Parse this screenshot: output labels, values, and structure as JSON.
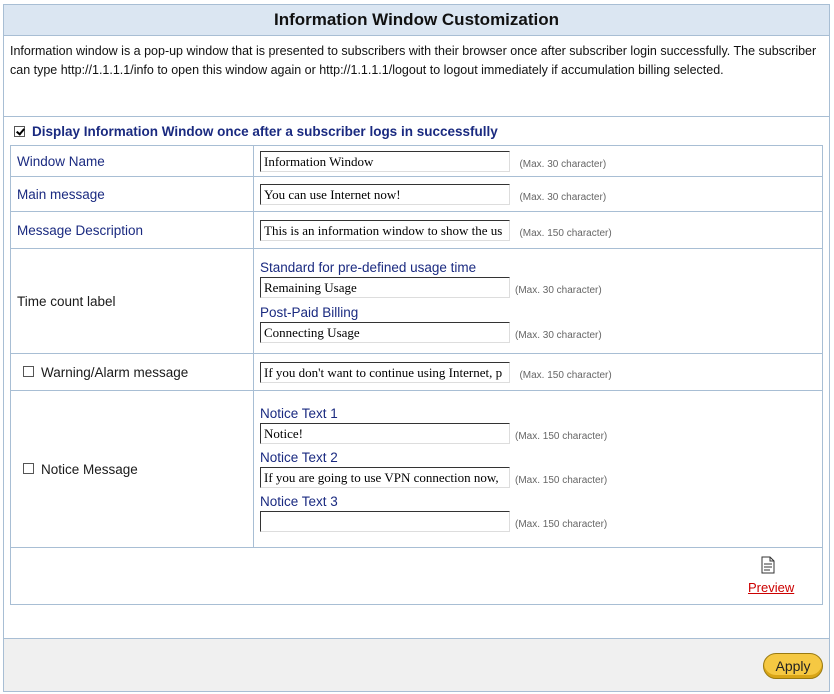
{
  "title": "Information Window Customization",
  "intro": "Information window is a pop-up window that is presented to subscribers with their browser once after subscriber login successfully. The subscriber can type http://1.1.1.1/info to open this window again or http://1.1.1.1/logout to logout immediately if accumulation billing selected.",
  "display_option": {
    "label": "Display Information Window once after a subscriber logs in successfully",
    "checked": true
  },
  "rows": {
    "window_name": {
      "label": "Window Name",
      "value": "Information Window",
      "hint": "(Max. 30 character)"
    },
    "main_message": {
      "label": "Main message",
      "value": "You can use Internet now!",
      "hint": "(Max. 30 character)"
    },
    "message_description": {
      "label": "Message Description",
      "value": "This is an information window to show the us",
      "hint": "(Max. 150 character)"
    },
    "time_count": {
      "label": "Time count label",
      "standard_label": "Standard for pre-defined usage time",
      "standard_value": "Remaining Usage",
      "standard_hint": "(Max. 30 character)",
      "postpaid_label": "Post-Paid Billing",
      "postpaid_value": "Connecting Usage",
      "postpaid_hint": "(Max. 30 character)"
    },
    "warning": {
      "label": "Warning/Alarm message",
      "checked": false,
      "value": "If you don't want to continue using Internet, p",
      "hint": "(Max. 150 character)"
    },
    "notice": {
      "label": "Notice Message",
      "checked": false,
      "text1_label": "Notice Text 1",
      "text1_value": "Notice!",
      "text1_hint": "(Max. 150 character)",
      "text2_label": "Notice Text 2",
      "text2_value": "If you are going to use VPN connection now,",
      "text2_hint": "(Max. 150 character)",
      "text3_label": "Notice Text 3",
      "text3_value": "",
      "text3_hint": "(Max. 150 character)"
    }
  },
  "preview": {
    "label": "Preview",
    "icon": "document-icon"
  },
  "apply_label": "Apply",
  "colors": {
    "header_bg": "#dbe6f2",
    "border": "#a8bed4",
    "label_blue": "#1a2a80",
    "link_red": "#cc0000",
    "button_yellow": "#f5c842"
  }
}
